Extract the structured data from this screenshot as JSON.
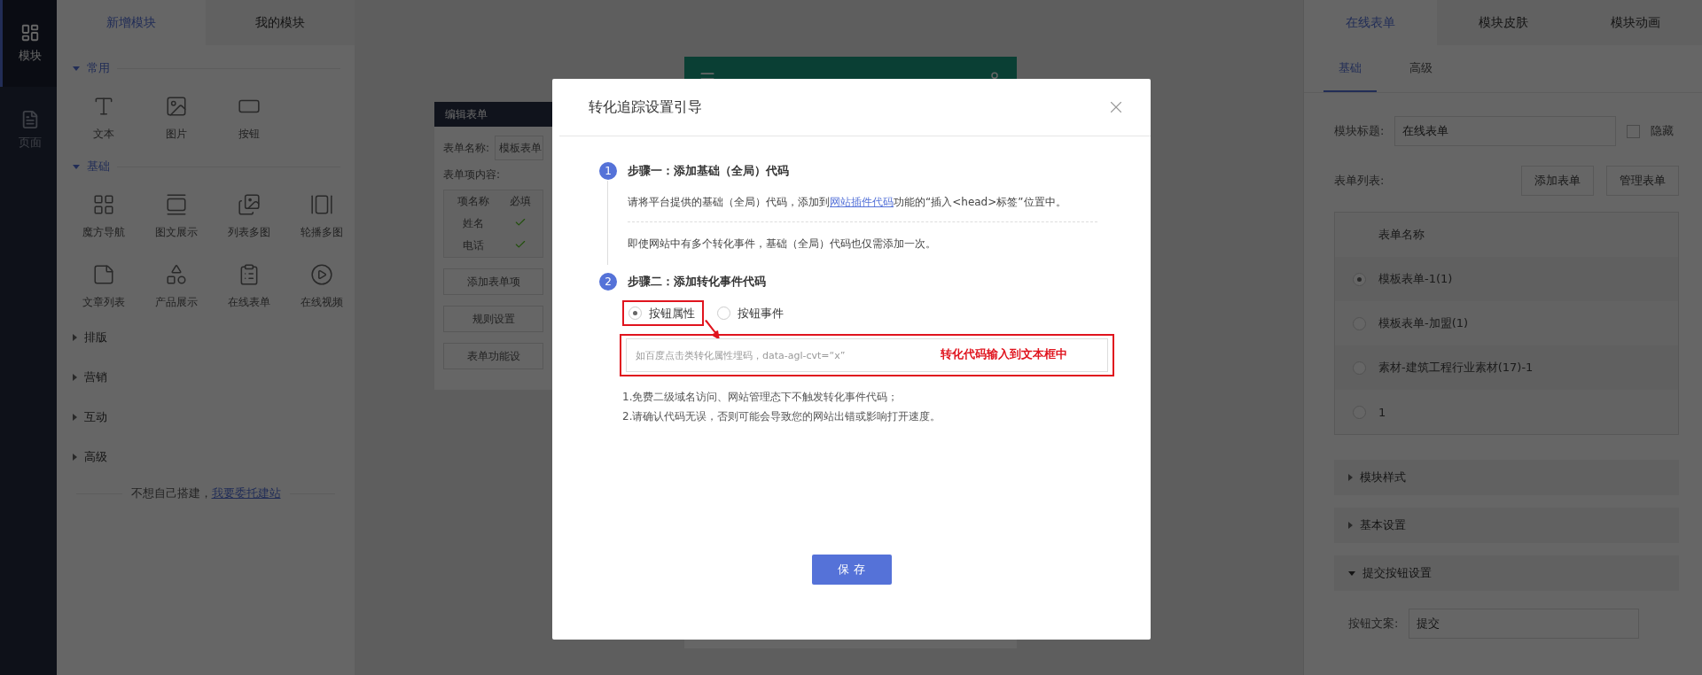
{
  "rail": [
    {
      "label": "模块",
      "selected": true
    },
    {
      "label": "页面",
      "selected": false
    }
  ],
  "left_panel": {
    "tabs": [
      {
        "label": "新增模块",
        "selected": true
      },
      {
        "label": "我的模块",
        "selected": false
      }
    ],
    "groups": [
      {
        "title": "常用",
        "expanded": true,
        "items": [
          {
            "label": "文本",
            "kind": "type"
          },
          {
            "label": "图片",
            "kind": "image"
          },
          {
            "label": "按钮",
            "kind": "button"
          }
        ]
      },
      {
        "title": "基础",
        "expanded": true,
        "items": [
          {
            "label": "魔方导航",
            "kind": "grid"
          },
          {
            "label": "图文展示",
            "kind": "image-text"
          },
          {
            "label": "列表多图",
            "kind": "images"
          },
          {
            "label": "轮播多图",
            "kind": "carousel"
          },
          {
            "label": "文章列表",
            "kind": "article"
          },
          {
            "label": "产品展示",
            "kind": "shapes"
          },
          {
            "label": "在线表单",
            "kind": "clipboard"
          },
          {
            "label": "在线视频",
            "kind": "play"
          }
        ]
      },
      {
        "title": "排版",
        "expanded": false
      },
      {
        "title": "营销",
        "expanded": false
      },
      {
        "title": "互动",
        "expanded": false
      },
      {
        "title": "高级",
        "expanded": false
      }
    ],
    "footer": {
      "text": "不想自己搭建，",
      "link": "我要委托建站"
    }
  },
  "edit_form": {
    "title": "编辑表单",
    "name_label": "表单名称:",
    "name_value": "模板表单",
    "items_label": "表单项内容:",
    "columns": [
      "项名称",
      "必填"
    ],
    "rows": [
      {
        "name": "姓名",
        "required": true
      },
      {
        "name": "电话",
        "required": true
      }
    ],
    "buttons": [
      "添加表单项",
      "规则设置",
      "表单功能设"
    ]
  },
  "right_panel": {
    "tabs": [
      {
        "label": "在线表单",
        "selected": true
      },
      {
        "label": "模块皮肤",
        "selected": false
      },
      {
        "label": "模块动画",
        "selected": false
      }
    ],
    "subtabs": [
      {
        "label": "基础",
        "selected": true
      },
      {
        "label": "高级",
        "selected": false
      }
    ],
    "title_label": "模块标题:",
    "title_value": "在线表单",
    "hide": {
      "label": "隐藏",
      "checked": false
    },
    "list_label": "表单列表:",
    "list_buttons": [
      "添加表单",
      "管理表单"
    ],
    "table_header": "表单名称",
    "forms": [
      {
        "name": "模板表单-1(1)",
        "selected": true
      },
      {
        "name": "模板表单-加盟(1)",
        "selected": false
      },
      {
        "name": "素材-建筑工程行业素材(17)-1",
        "selected": false
      },
      {
        "name": "1",
        "selected": false
      }
    ],
    "sections": [
      {
        "title": "模块样式",
        "expanded": false
      },
      {
        "title": "基本设置",
        "expanded": false
      },
      {
        "title": "提交按钮设置",
        "expanded": true
      }
    ],
    "button_text_label": "按钮文案:",
    "button_text_value": "提交"
  },
  "dialog": {
    "title": "转化追踪设置引导",
    "step1": {
      "number": "1",
      "title": "步骤一：添加基础（全局）代码",
      "text_before": "请将平台提供的基础（全局）代码，添加到",
      "link": "网站插件代码",
      "text_after": "功能的“插入<head>标签”位置中。",
      "note": "即使网站中有多个转化事件，基础（全局）代码也仅需添加一次。"
    },
    "step2": {
      "number": "2",
      "title": "步骤二：添加转化事件代码",
      "options": [
        {
          "label": "按钮属性",
          "selected": true,
          "highlighted": true
        },
        {
          "label": "按钮事件",
          "selected": false,
          "highlighted": false
        }
      ],
      "field": {
        "placeholder": "如百度点击类转化属性埋码，data-agl-cvt=“x”",
        "highlighted": true,
        "annotation": "转化代码输入到文本框中"
      },
      "notes": [
        "1.免费二级域名访问、网站管理态下不触发转化事件代码；",
        "2.请确认代码无误，否则可能会导致您的网站出错或影响打开速度。"
      ]
    },
    "save": "保 存"
  }
}
